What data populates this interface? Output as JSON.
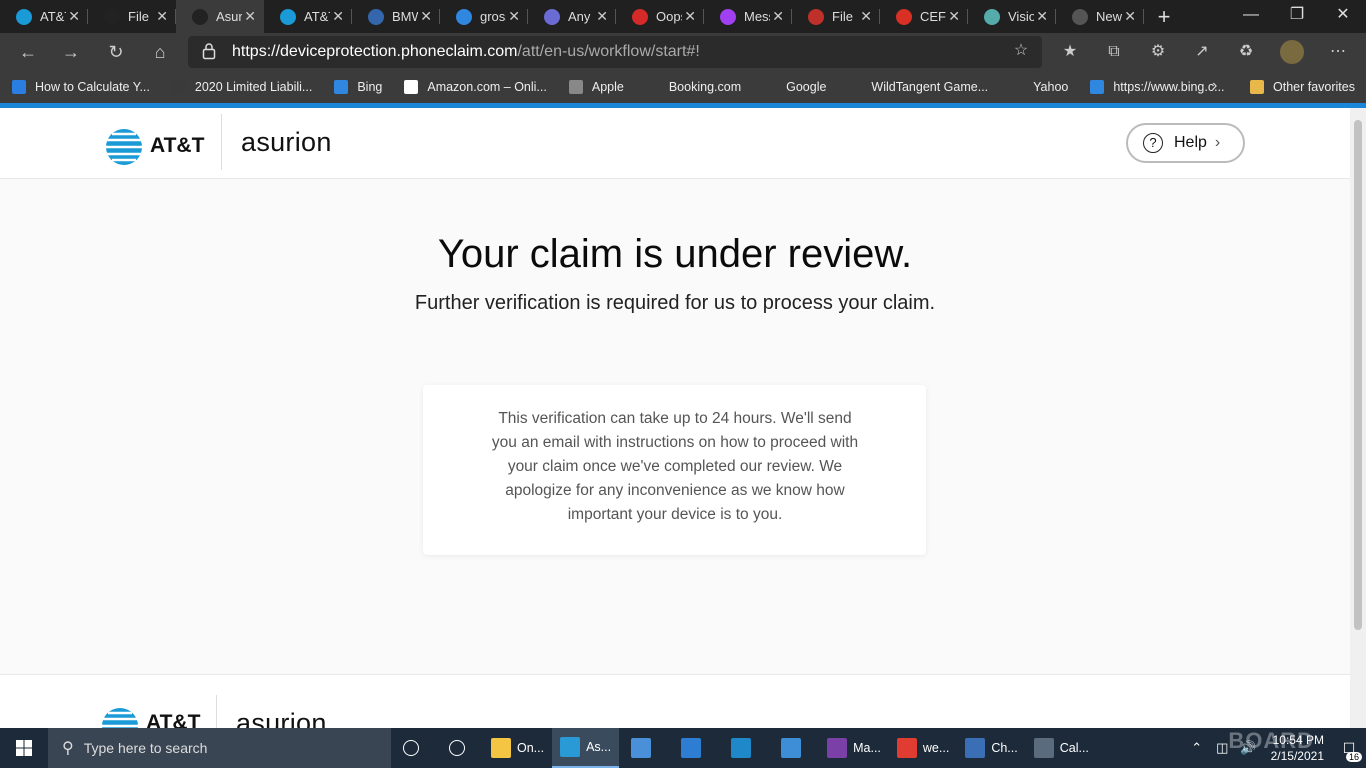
{
  "tabs": [
    {
      "label": "AT&T",
      "icon": "att-globe-icon",
      "color": "#1a9ad6"
    },
    {
      "label": "File",
      "icon": "asurion-icon",
      "color": "#222"
    },
    {
      "label": "Asurion",
      "icon": "asurion-icon",
      "color": "#222",
      "active": true
    },
    {
      "label": "AT&T",
      "icon": "att-globe-icon",
      "color": "#1a9ad6"
    },
    {
      "label": "BMW",
      "icon": "bmw-icon",
      "color": "#3366aa"
    },
    {
      "label": "gross",
      "icon": "bing-icon",
      "color": "#2f87e0"
    },
    {
      "label": "Any",
      "icon": "any-icon",
      "color": "#6b6bd6"
    },
    {
      "label": "Oops",
      "icon": "oops-icon",
      "color": "#d42a2a"
    },
    {
      "label": "Messenger",
      "icon": "messenger-icon",
      "color": "#a040f0"
    },
    {
      "label": "File",
      "icon": "shield-icon",
      "color": "#c0302b"
    },
    {
      "label": "CEF",
      "icon": "gmail-icon",
      "color": "#d93025"
    },
    {
      "label": "Visio",
      "icon": "visio-icon",
      "color": "#5aa"
    },
    {
      "label": "New",
      "icon": "newtab-icon",
      "color": "#555"
    }
  ],
  "address": {
    "host": "https://deviceprotection.phoneclaim.com",
    "path": "/att/en-us/workflow/start#!"
  },
  "favorites": [
    {
      "label": "How to Calculate Y...",
      "color": "#2a7de1"
    },
    {
      "label": "2020 Limited Liabili...",
      "color": "#3a3a3a"
    },
    {
      "label": "Bing",
      "color": "#2f87e0"
    },
    {
      "label": "Amazon.com – Onli...",
      "color": "#ffffff"
    },
    {
      "label": "Apple",
      "color": "#888"
    },
    {
      "label": "Booking.com",
      "color": "#3b3b3b"
    },
    {
      "label": "Google",
      "color": "#3b3b3b"
    },
    {
      "label": "WildTangent Game...",
      "color": "#3b3b3b"
    },
    {
      "label": "Yahoo",
      "color": "#3b3b3b"
    },
    {
      "label": "https://www.bing.c...",
      "color": "#2f87e0"
    }
  ],
  "other_favorites": "Other favorites",
  "header": {
    "att_logo": "AT&T",
    "asurion_logo": "asurion",
    "help_label": "Help"
  },
  "main": {
    "title": "Your claim is under review.",
    "subtitle": "Further verification is required for us to process your claim.",
    "card_text": "This verification can take up to 24 hours. We'll send you an email with instructions on how to proceed with your claim once we've completed our review. We apologize for any inconvenience as we know how important your device is to you."
  },
  "footer": {
    "att_logo": "AT&T",
    "asurion_logo": "asurion"
  },
  "taskbar": {
    "search_placeholder": "Type here to search",
    "apps": [
      {
        "label": "",
        "icon": "cortana-icon"
      },
      {
        "label": "",
        "icon": "task-view-icon"
      },
      {
        "label": "On...",
        "icon": "file-explorer-icon",
        "color": "#f4c542"
      },
      {
        "label": "As...",
        "icon": "edge-icon",
        "color": "#2a9ad6",
        "active": true
      },
      {
        "label": "",
        "icon": "store-icon",
        "color": "#4a90d9"
      },
      {
        "label": "",
        "icon": "mail-icon",
        "color": "#2d7dd2"
      },
      {
        "label": "",
        "icon": "edge-legacy-icon",
        "color": "#1e88c8"
      },
      {
        "label": "",
        "icon": "image-icon",
        "color": "#3d8ed6"
      },
      {
        "label": "Ma...",
        "icon": "onenote-icon",
        "color": "#7b3fa8"
      },
      {
        "label": "we...",
        "icon": "pdf-icon",
        "color": "#e03c31"
      },
      {
        "label": "Ch...",
        "icon": "checkbook-icon",
        "color": "#3a6fb5"
      },
      {
        "label": "Cal...",
        "icon": "calculator-icon",
        "color": "#5a6b7d"
      }
    ],
    "time": "10:54 PM",
    "date": "2/15/2021",
    "notification_count": "16",
    "watermark": "BOARD"
  }
}
